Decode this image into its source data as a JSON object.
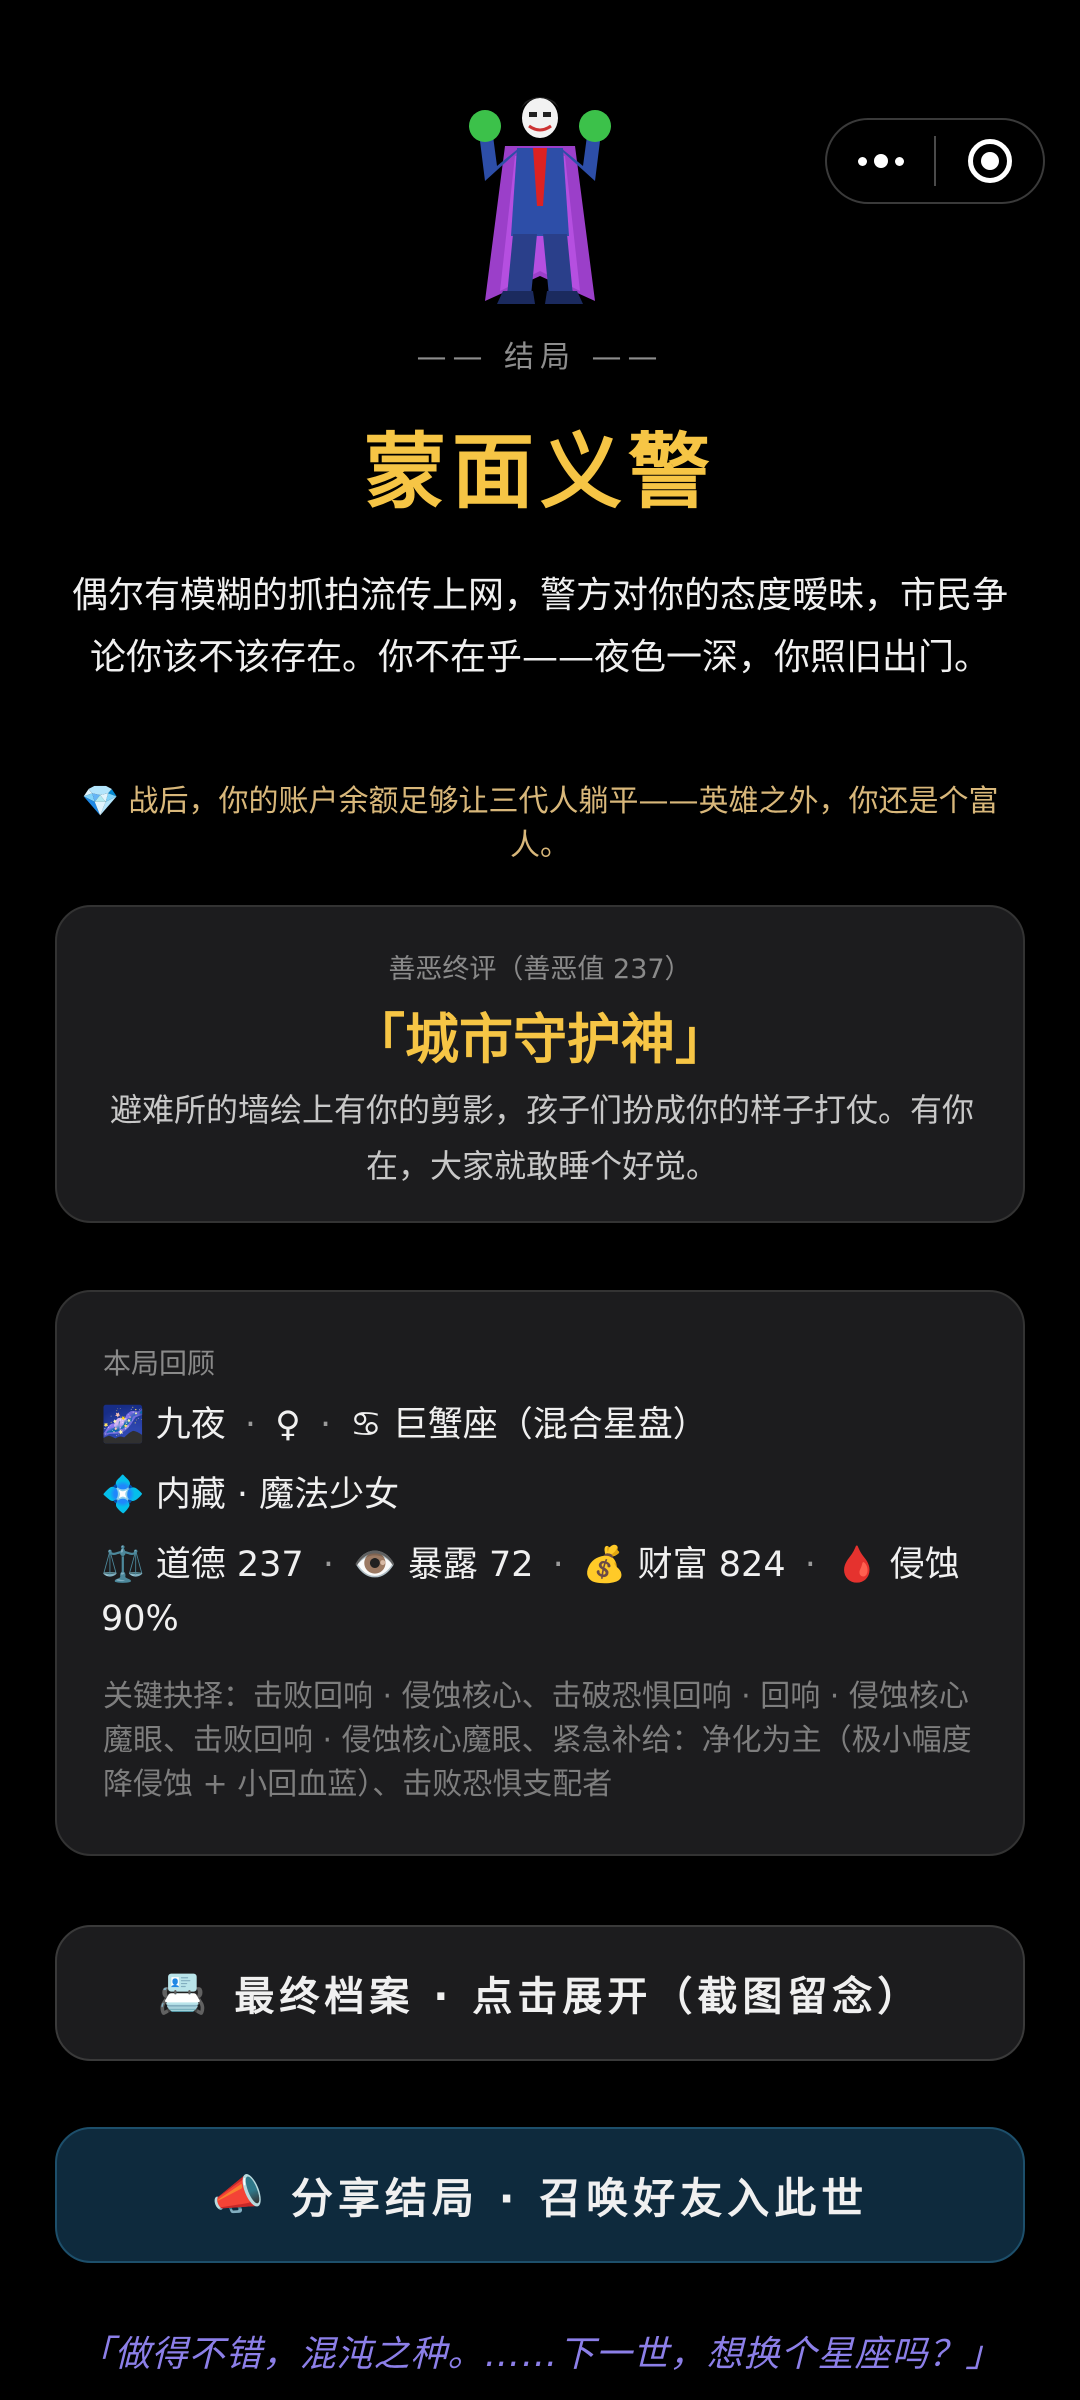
{
  "ending": {
    "kicker": "—— 结局 ——",
    "title": "蒙面义警",
    "description": "偶尔有模糊的抓拍流传上网，警方对你的态度暧昧，市民争论你该不该存在。你不在乎——夜色一深，你照旧出门。",
    "note_icon": "💎",
    "note": "战后，你的账户余额足够让三代人躺平——英雄之外，你还是个富人。"
  },
  "verdict": {
    "label": "善恶终评（善恶值 237）",
    "name": "「城市守护神」",
    "text": "避难所的墙绘上有你的剪影，孩子们扮成你的样子打仗。有你在，大家就敢睡个好觉。"
  },
  "recap": {
    "label": "本局回顾",
    "line1": {
      "icon": "🌌",
      "name": "九夜",
      "gender": "♀",
      "sign_icon": "♋",
      "sign": "巨蟹座（混合星盘）"
    },
    "line2": {
      "icon": "💠",
      "text": "内藏 · 魔法少女"
    },
    "line3": {
      "morality_icon": "⚖️",
      "morality": "道德 237",
      "exposure_icon": "👁️",
      "exposure": "暴露 72",
      "wealth_icon": "💰",
      "wealth": "财富 824",
      "erosion_icon": "🩸",
      "erosion": "侵蚀 90%"
    },
    "choices": "关键抉择：击败回响 · 侵蚀核心、击破恐惧回响 · 回响 · 侵蚀核心魔眼、击败回响 · 侵蚀核心魔眼、紧急补给：净化为主（极小幅度降侵蚀 + 小回血蓝）、击败恐惧支配者"
  },
  "buttons": {
    "archive_icon": "📇",
    "archive": "最终档案 · 点击展开（截图留念）",
    "share_icon": "📣",
    "share": "分享结局 · 召唤好友入此世"
  },
  "quote": "「做得不错，混沌之种。……下一世，想换个星座吗？」",
  "capsule": {
    "more_icon": "more-dots-icon",
    "close_icon": "target-circle-icon"
  },
  "colors": {
    "title": "#f6c545",
    "note": "#d8b77a",
    "quote": "#8c7fe8",
    "share_bg": "#0e2a3d"
  }
}
